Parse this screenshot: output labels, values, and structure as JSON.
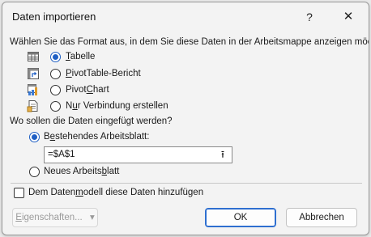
{
  "dialog": {
    "title": "Daten importieren",
    "help_glyph": "?",
    "close_glyph": "✕"
  },
  "format_section": {
    "prompt": "Wählen Sie das Format aus, in dem Sie diese Daten in der Arbeitsmappe anzeigen möchten.",
    "options": [
      {
        "label_u": "T",
        "label_rest": "abelle",
        "checked": true,
        "icon": "table-icon"
      },
      {
        "label_u": "P",
        "label_rest": "ivotTable-Bericht",
        "checked": false,
        "icon": "pivottable-icon"
      },
      {
        "label_pre": "Pivot",
        "label_u": "C",
        "label_rest": "hart",
        "checked": false,
        "icon": "pivotchart-icon"
      },
      {
        "label_pre": "N",
        "label_u": "u",
        "label_rest": "r Verbindung erstellen",
        "checked": false,
        "icon": "connection-icon"
      }
    ]
  },
  "location_section": {
    "prompt": "Wo sollen die Daten eingefügt werden?",
    "existing_label_pre": "B",
    "existing_label_u": "e",
    "existing_label_rest": "stehendes Arbeitsblatt:",
    "existing_checked": true,
    "cell_reference": "=$A$1",
    "collapse_glyph": "⭱",
    "new_label_pre": "Neues Arbeits",
    "new_label_u": "b",
    "new_label_rest": "latt",
    "new_checked": false
  },
  "datamodel": {
    "label_pre": "Dem Daten",
    "label_u": "m",
    "label_rest": "odell diese Daten hinzufügen",
    "checked": false
  },
  "buttons": {
    "properties_u": "E",
    "properties_rest": "igenschaften...",
    "properties_arrow": "▾",
    "ok": "OK",
    "cancel": "Abbrechen"
  }
}
